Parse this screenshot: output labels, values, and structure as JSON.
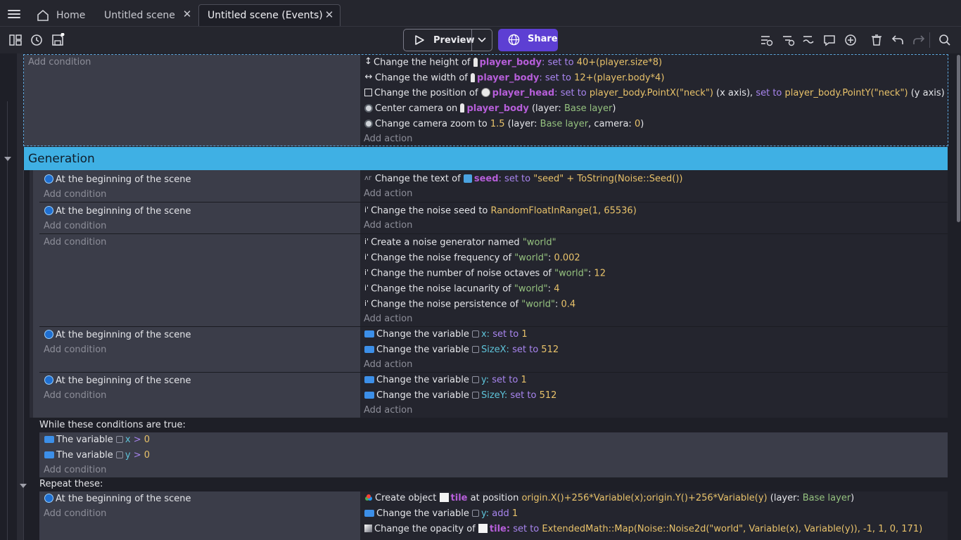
{
  "tabs": [
    {
      "label": "Home"
    },
    {
      "label": "Untitled scene"
    },
    {
      "label": "Untitled scene (Events)"
    }
  ],
  "toolbar": {
    "preview_label": "Preview",
    "share_label": "Share"
  },
  "add_condition": "Add condition",
  "add_action": "Add action",
  "top_event": {
    "actions": {
      "height": {
        "pre": "Change the height of",
        "obj": "player_body",
        "set": "set to",
        "val": "40+(player.size*8)"
      },
      "width": {
        "pre": "Change the width of",
        "obj": "player_body",
        "set": "set to",
        "val": "12+(player.body*4)"
      },
      "position": {
        "pre": "Change the position of",
        "obj": "player_head",
        "set1": "set to",
        "val1": "player_body.PointX(\"neck\")",
        "mid": "(x axis),",
        "set2": "set to",
        "val2": "player_body.PointY(\"neck\")",
        "post": "(y axis)"
      },
      "center": {
        "pre": "Center camera on",
        "obj": "player_body",
        "layer_pre": "(layer:",
        "layer": "Base layer",
        "layer_post": ")"
      },
      "zoom": {
        "pre": "Change camera zoom to",
        "val": "1.5",
        "layer_pre": "(layer:",
        "layer": "Base layer",
        "camera_pre": ", camera:",
        "camera": "0",
        "post": ")"
      }
    }
  },
  "group": {
    "title": "Generation"
  },
  "events": {
    "scene_start": "At the beginning of the scene",
    "e1": {
      "pre": "Change the text of",
      "obj": "seed",
      "set": "set to",
      "val": "\"seed\" + ToString(Noise::Seed())"
    },
    "e2": {
      "pre": "Change the noise seed to",
      "val": "RandomFloatInRange(1, 65536)"
    },
    "e3": {
      "create": {
        "pre": "Create a noise generator named",
        "val": "\"world\""
      },
      "freq": {
        "pre": "Change the noise frequency of",
        "name": "\"world\"",
        "val": "0.002"
      },
      "oct": {
        "pre": "Change the number of noise octaves of",
        "name": "\"world\"",
        "val": "12"
      },
      "lac": {
        "pre": "Change the noise lacunarity of",
        "name": "\"world\"",
        "val": "4"
      },
      "pers": {
        "pre": "Change the noise persistence of",
        "name": "\"world\"",
        "val": "0.4"
      }
    },
    "e4": {
      "a1": {
        "pre": "Change the variable",
        "var": "x:",
        "set": "set to",
        "val": "1"
      },
      "a2": {
        "pre": "Change the variable",
        "var": "SizeX:",
        "set": "set to",
        "val": "512"
      }
    },
    "e5": {
      "a1": {
        "pre": "Change the variable",
        "var": "y:",
        "set": "set to",
        "val": "1"
      },
      "a2": {
        "pre": "Change the variable",
        "var": "SizeY:",
        "set": "set to",
        "val": "512"
      }
    }
  },
  "while_block": {
    "header": "While these conditions are true:",
    "c1": {
      "pre": "The variable",
      "var": "x",
      "op": ">",
      "val": "0"
    },
    "c2": {
      "pre": "The variable",
      "var": "y",
      "op": ">",
      "val": "0"
    },
    "repeat": "Repeat these:",
    "a1": {
      "pre": "Create object",
      "obj": "tile",
      "mid": "at position",
      "val": "origin.X()+256*Variable(x);origin.Y()+256*Variable(y)",
      "layer_pre": "(layer:",
      "layer": "Base layer",
      "post": ")"
    },
    "a2": {
      "pre": "Change the variable",
      "var": "y:",
      "set": "add",
      "val": "1"
    },
    "a3": {
      "pre": "Change the opacity of",
      "obj": "tile:",
      "set": "set to",
      "val": "ExtendedMath::Map(Noise::Noise2d(\"world\", Variable(x), Variable(y)), -1, 1, 0, 171)"
    }
  }
}
